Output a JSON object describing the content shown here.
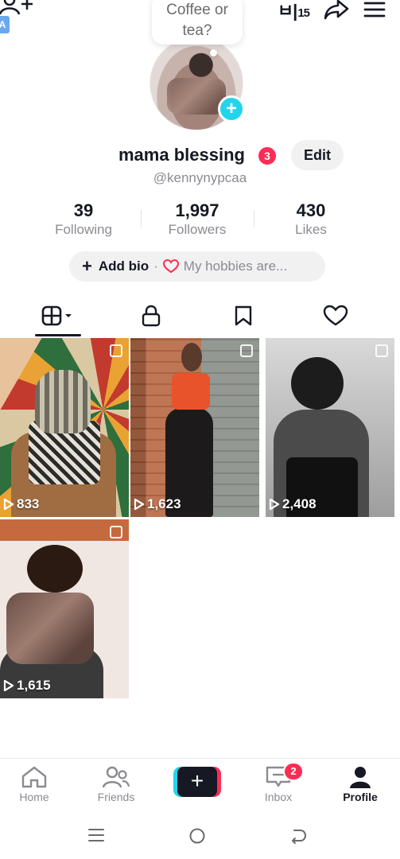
{
  "topbar": {
    "add_friend_icon": "add-person-icon",
    "translate_chip": "A",
    "chinese_label": "ㅂ|",
    "chinese_count": "15",
    "share_icon": "share-arrow-icon",
    "menu_icon": "hamburger-icon"
  },
  "bubble": {
    "line1": "Coffee or",
    "line2": "tea?"
  },
  "profile": {
    "name": "mama blessing",
    "notification_count": "3",
    "edit_label": "Edit",
    "username": "@kennynypcaa"
  },
  "stats": [
    {
      "value": "39",
      "label": "Following"
    },
    {
      "value": "1,997",
      "label": "Followers"
    },
    {
      "value": "430",
      "label": "Likes"
    }
  ],
  "bio": {
    "add_label": "Add bio",
    "separator": "·",
    "hobby_text": "My hobbies are..."
  },
  "tabs": [
    {
      "name": "videos",
      "icon": "grid-icon",
      "active": true
    },
    {
      "name": "private",
      "icon": "lock-icon"
    },
    {
      "name": "saved",
      "icon": "bookmark-icon"
    },
    {
      "name": "liked",
      "icon": "heart-icon"
    }
  ],
  "videos": [
    {
      "views": "833"
    },
    {
      "views": "1,623"
    },
    {
      "views": "2,408"
    },
    {
      "views": "1,615"
    }
  ],
  "bottom_nav": {
    "home": "Home",
    "friends": "Friends",
    "create": "+",
    "inbox": "Inbox",
    "inbox_badge": "2",
    "profile": "Profile"
  },
  "colors": {
    "accent_red": "#fe2c55",
    "accent_cyan": "#20d5ec",
    "text": "#161823",
    "muted": "#8a8b91"
  }
}
